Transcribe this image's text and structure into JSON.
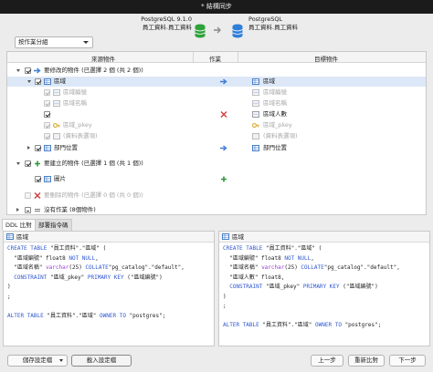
{
  "window": {
    "title": "* 結構同步"
  },
  "source": {
    "server": "PostgreSQL 9.1.0",
    "schema": "員工資料.員工資料"
  },
  "target": {
    "server": "PostgreSQL",
    "schema": "員工資料.員工資料"
  },
  "group_select": {
    "value": "按作業分組"
  },
  "columns": {
    "source": "來源物件",
    "action": "作業",
    "target": "目標物件"
  },
  "tree": {
    "modify_group": "要修改的物件 (已選擇 2 個 (共 2 個))",
    "table1_src": "區域",
    "table1_tgt": "區域",
    "fields_src": [
      "區域編號",
      "區域名稱",
      "",
      "區域_pkey",
      "(資料表選項)"
    ],
    "fields_tgt": [
      "區域編號",
      "區域名稱",
      "區域人數",
      "區域_pkey",
      "(資料表選項)"
    ],
    "table2_src": "部門位置",
    "table2_tgt": "部門位置",
    "create_group": "要建立的物件 (已選擇 1 個 (共 1 個))",
    "create_item": "圖片",
    "delete_group": "要刪除的物件 (已選擇 0 個 (共 0 個))",
    "noop_group": "沒有作業 (8個物件)"
  },
  "tabs": {
    "ddl": "DDL 比對",
    "deploy": "部署指令碼"
  },
  "ddl_left": {
    "title": "區域",
    "lines": [
      [
        [
          "kw",
          "CREATE TABLE "
        ],
        [
          "",
          "\"員工資料\".\"區域\" ("
        ]
      ],
      [
        [
          "",
          "  \"區域編號\" float8 "
        ],
        [
          "kw",
          "NOT NULL"
        ],
        [
          "",
          ","
        ]
      ],
      [
        [
          "",
          "  \"區域名稱\" "
        ],
        [
          "tp",
          "varchar"
        ],
        [
          "",
          "(25) "
        ],
        [
          "kw",
          "COLLATE"
        ],
        [
          "",
          "\"pg_catalog\".\"default\","
        ]
      ],
      [
        [
          "kw",
          "  CONSTRAINT "
        ],
        [
          "",
          "\"區域_pkey\" "
        ],
        [
          "kw",
          "PRIMARY KEY"
        ],
        [
          "",
          " (\"區域編號\")"
        ]
      ],
      [
        [
          "",
          ")"
        ]
      ],
      [
        [
          "",
          ";"
        ]
      ],
      [
        [
          "",
          ""
        ]
      ],
      [
        [
          "kw",
          "ALTER TABLE "
        ],
        [
          "",
          "\"員工資料\".\"區域\" "
        ],
        [
          "kw",
          "OWNER TO "
        ],
        [
          "",
          "\"postgres\";"
        ]
      ]
    ]
  },
  "ddl_right": {
    "title": "區域",
    "lines": [
      [
        [
          "kw",
          "CREATE TABLE "
        ],
        [
          "",
          "\"員工資料\".\"區域\" ("
        ]
      ],
      [
        [
          "",
          "  \"區域編號\" float8 "
        ],
        [
          "kw",
          "NOT NULL"
        ],
        [
          "",
          ","
        ]
      ],
      [
        [
          "",
          "  \"區域名稱\" "
        ],
        [
          "tp",
          "varchar"
        ],
        [
          "",
          "(25) "
        ],
        [
          "kw",
          "COLLATE"
        ],
        [
          "",
          "\"pg_catalog\".\"default\","
        ]
      ],
      [
        [
          "",
          "  \"區域人數\" float8,"
        ]
      ],
      [
        [
          "kw",
          "  CONSTRAINT "
        ],
        [
          "",
          "\"區域_pkey\" "
        ],
        [
          "kw",
          "PRIMARY KEY"
        ],
        [
          "",
          " (\"區域編號\")"
        ]
      ],
      [
        [
          "",
          ")"
        ]
      ],
      [
        [
          "",
          ";"
        ]
      ],
      [
        [
          "",
          ""
        ]
      ],
      [
        [
          "kw",
          "ALTER TABLE "
        ],
        [
          "",
          "\"員工資料\".\"區域\" "
        ],
        [
          "kw",
          "OWNER TO "
        ],
        [
          "",
          "\"postgres\";"
        ]
      ]
    ]
  },
  "buttons": {
    "save_profile": "儲存設定檔",
    "load_profile": "載入設定檔",
    "prev": "上一步",
    "recompare": "重新比對",
    "next": "下一步"
  },
  "colors": {
    "blue_arrow": "#3a7bd5",
    "red_x": "#d23a3a",
    "green_plus": "#2f9a3a",
    "db_green": "#2fa23a",
    "db_blue": "#2f7fd8"
  }
}
